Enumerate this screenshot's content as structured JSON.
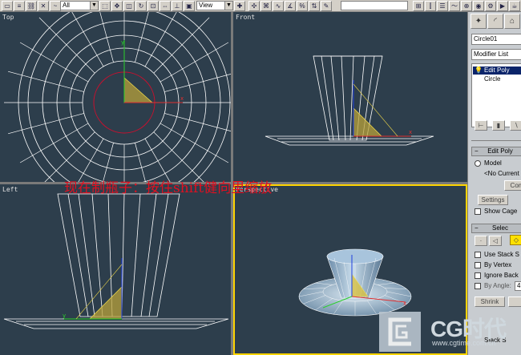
{
  "toolbar": {
    "selection_filter": "All",
    "reference_coord": "View",
    "named_selection": ""
  },
  "viewports": {
    "top": {
      "label": "Top"
    },
    "front": {
      "label": "Front"
    },
    "left": {
      "label": "Left"
    },
    "perspective": {
      "label": "Perspective"
    }
  },
  "overlay_caption": "现在制瓶子：按住shift健向里缩放",
  "command_panel": {
    "object_name": "Circle01",
    "modifier_list": "Modifier List",
    "stack": [
      {
        "label": "Edit Poly",
        "selected": true
      },
      {
        "label": "Circle",
        "selected": false
      }
    ],
    "edit_poly_rollout": {
      "title": "Edit Poly",
      "mode_model": "Model",
      "no_current": "<No Current",
      "commit": "Com",
      "settings": "Settings",
      "show_cage": "Show Cage"
    },
    "selection_rollout": {
      "title": "Selec",
      "use_stack": "Use Stack S",
      "by_vertex": "By Vertex",
      "ignore_back": "Ignore Back",
      "by_angle": "By Angle:",
      "by_angle_value": "4",
      "shrink": "Shrink",
      "stack_sel": "Stack S"
    }
  },
  "watermark": {
    "title": "CG时代",
    "url": "www.cgtime.com.cn"
  },
  "colors": {
    "viewport_bg": "#2d3e4c",
    "wire": "#ffffff",
    "active_border": "#ffd400",
    "caption": "#e01020"
  }
}
